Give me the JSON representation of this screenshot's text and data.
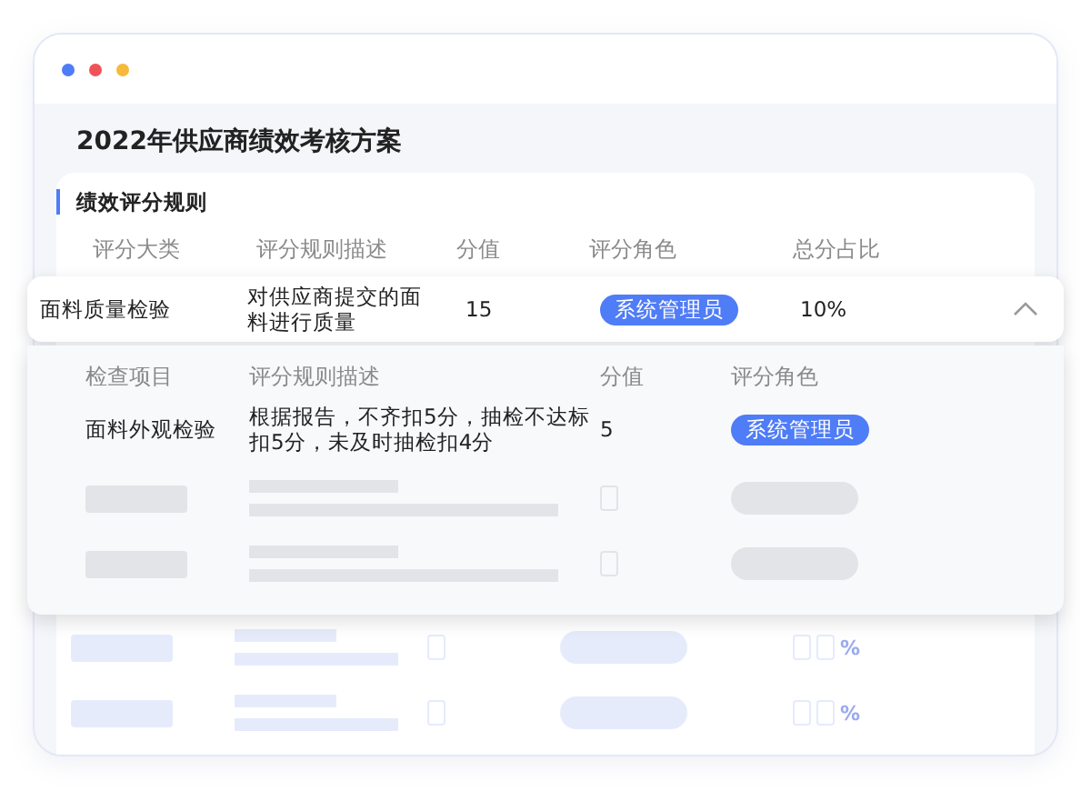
{
  "window": {
    "title": "2022年供应商绩效考核方案"
  },
  "section": {
    "title": "绩效评分规则"
  },
  "table": {
    "columns": [
      "评分大类",
      "评分规则描述",
      "分值",
      "评分角色",
      "总分占比"
    ],
    "rows": [
      {
        "category": "面料质量检验",
        "description": "对供应商提交的面料进行质量",
        "score": "15",
        "role": "系统管理员",
        "share": "10%",
        "expanded": true,
        "details": {
          "columns": [
            "检查项目",
            "评分规则描述",
            "分值",
            "评分角色"
          ],
          "rows": [
            {
              "item": "面料外观检验",
              "description": "根据报告，不齐扣5分，抽检不达标扣5分，未及时抽检扣4分",
              "score": "5",
              "role": "系统管理员"
            }
          ]
        }
      }
    ]
  },
  "background_rows": [
    {
      "percent": "%"
    },
    {
      "percent": "%"
    }
  ]
}
